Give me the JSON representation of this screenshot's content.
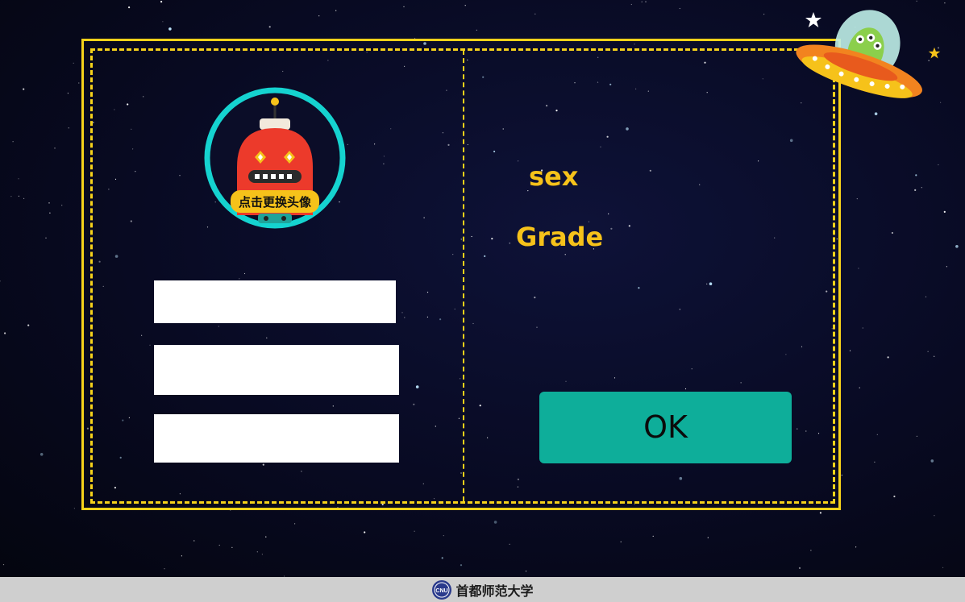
{
  "avatar": {
    "caption": "点击更换头像"
  },
  "form": {
    "field1_value": "",
    "field2_value": "",
    "field3_value": ""
  },
  "labels": {
    "sex": "sex",
    "grade": "Grade"
  },
  "actions": {
    "ok_label": "OK"
  },
  "footer": {
    "institution": "首都师范大学",
    "seal_text": "CNU"
  },
  "colors": {
    "accent_yellow": "#f6d21a",
    "label_yellow": "#f6c21a",
    "ok_button": "#0eae9a",
    "avatar_ring": "#15d3d0",
    "robot_red": "#ec3a2b",
    "footer_bg": "#cfcfcf"
  },
  "icons": [
    "robot-avatar-icon",
    "ufo-alien-icon",
    "star-icon",
    "university-seal-icon"
  ]
}
